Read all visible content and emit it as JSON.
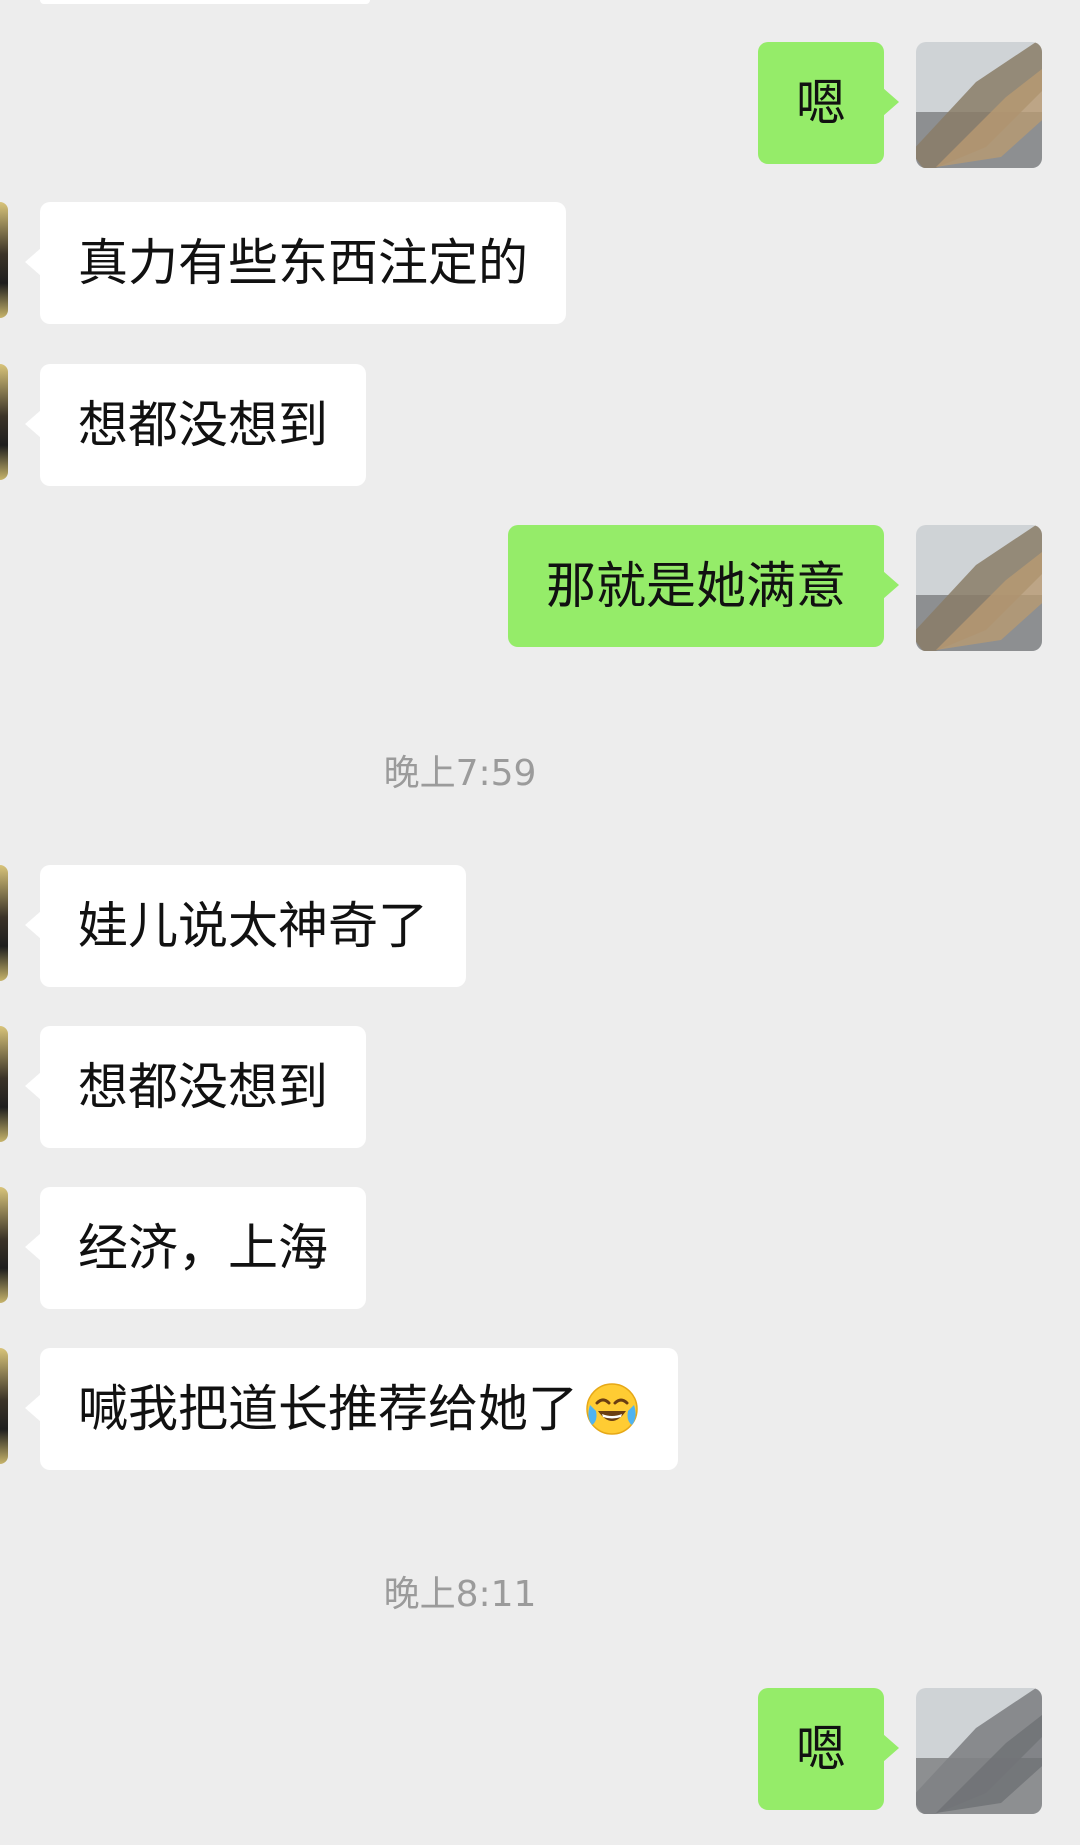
{
  "messages": [
    {
      "side": "out",
      "text": "嗯"
    },
    {
      "side": "in",
      "text": "真力有些东西注定的"
    },
    {
      "side": "in",
      "text": "想都没想到"
    },
    {
      "side": "out",
      "text": "那就是她满意"
    },
    {
      "side": "time",
      "text": "晚上7:59"
    },
    {
      "side": "in",
      "text": "娃儿说太神奇了"
    },
    {
      "side": "in",
      "text": "想都没想到"
    },
    {
      "side": "in",
      "text": "经济，上海"
    },
    {
      "side": "in",
      "text": "喊我把道长推荐给她了",
      "emoji": "crying-laughing-emoji"
    },
    {
      "side": "time",
      "text": "晚上8:11"
    },
    {
      "side": "out",
      "text": "嗯"
    }
  ],
  "colors": {
    "background": "#ededed",
    "incoming_bubble": "#ffffff",
    "outgoing_bubble": "#95ec69",
    "timestamp_text": "#9b9b9b"
  }
}
